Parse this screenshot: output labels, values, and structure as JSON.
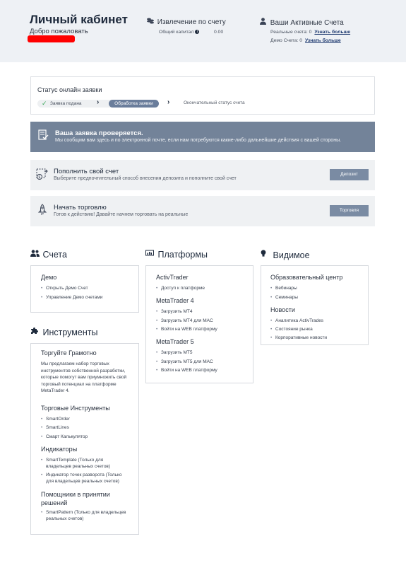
{
  "header": {
    "title": "Личный кабинет",
    "welcome": "Добро пожаловать",
    "funds": {
      "title": "Извлечение по счету",
      "capital_label": "Общий капитал",
      "capital_value": "0.00"
    },
    "accounts": {
      "title": "Ваши Активные Счета",
      "real": "Реальные счета: 0",
      "demo": "Демо Счета: 0",
      "learn_more": "Узнать больше"
    }
  },
  "status": {
    "title": "Статус онлайн заявки",
    "step1": "Заявка подана",
    "step2": "Обработка заявки",
    "step3": "Окончательный статус счета"
  },
  "notice": {
    "heading": "Ваша заявка проверяется.",
    "text": "Мы сообщим вам здесь и по электронной почте, если нам потребуются какие-либо дальнейшие действия с вашей стороны."
  },
  "deposit": {
    "heading": "Пополнить свой счет",
    "text": "Выберите предпочтительный способ внесения депозита и пополните свой счет",
    "button": "Депозит"
  },
  "trade": {
    "heading": "Начать торговлю",
    "text": "Готов к действию! Давайте начнем торговать на реальные",
    "button": "Торговля"
  },
  "accounts_section": {
    "title": "Счета",
    "demo_heading": "Демо",
    "items": [
      "Открыть Демо Счет",
      "Управление Демо счетами"
    ]
  },
  "platforms": {
    "title": "Платформы",
    "groups": [
      {
        "name": "ActivTrader",
        "items": [
          "Доступ к платформе"
        ]
      },
      {
        "name": "MetaTrader 4",
        "items": [
          "Загрузить MT4",
          "Загрузить MT4 для MAC",
          "Войти на WEB платформу"
        ]
      },
      {
        "name": "MetaTrader 5",
        "items": [
          "Загрузить MT5",
          "Загрузить MT5 для MAC",
          "Войти на WEB платформу"
        ]
      }
    ]
  },
  "visible": {
    "title": "Видимое",
    "groups": [
      {
        "name": "Образовательный центр",
        "items": [
          "Вебинары",
          "Семинары"
        ]
      },
      {
        "name": "Новости",
        "items": [
          "Аналитика ActivTrades",
          "Состояние рынка",
          "Корпоративные новости"
        ]
      }
    ]
  },
  "tools": {
    "title": "Инструменты",
    "smart_heading": "Торгуйте Грамотно",
    "smart_text": [
      "Мы предлагаем набор торговых",
      "инструментов собственной разработки,",
      "которые помогут вам приумножить свой",
      "торговый потенциал на платформе",
      "MetaTrader 4."
    ],
    "trading_heading": "Торговые Инструменты",
    "trading_items": [
      "SmartOrder",
      "SmartLines",
      "Смарт Калькулятор"
    ],
    "indicators_heading": "Индикаторы",
    "indicator_items": [
      [
        "SmartTemplate (Только для",
        "владельцев реальных счетов)"
      ],
      [
        "Индикатор точек разворота (Только",
        "для владельцев реальных счетов)"
      ]
    ],
    "assistants_heading": [
      "Помощники в принятии",
      "решений"
    ],
    "assistant_items": [
      [
        "SmartPattern (Только для владельцев",
        "реальных счетов)"
      ]
    ]
  }
}
